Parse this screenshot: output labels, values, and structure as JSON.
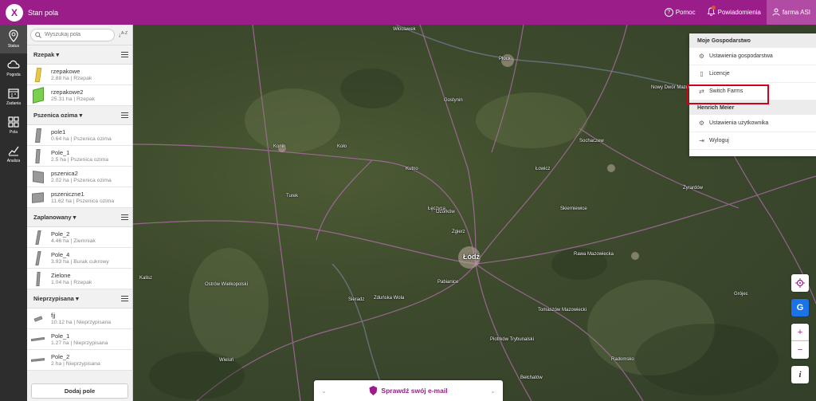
{
  "header": {
    "title": "Stan pola",
    "help": "Pomoc",
    "notifications": "Powiadomienia",
    "farm": "farma ASI"
  },
  "nav": [
    {
      "label": "Status",
      "icon": "pin-icon"
    },
    {
      "label": "Pogoda",
      "icon": "cloud-icon"
    },
    {
      "label": "Zadania",
      "icon": "calendar-icon"
    },
    {
      "label": "Pola",
      "icon": "fields-icon"
    },
    {
      "label": "Analiza",
      "icon": "chart-icon"
    }
  ],
  "search": {
    "placeholder": "Wyszukaj pola",
    "sort": "A-Z"
  },
  "groups": [
    {
      "name": "Rzepak",
      "fields": [
        {
          "name": "rzepakowe",
          "info": "2.88 ha | Rzepak"
        },
        {
          "name": "rzepakowe2",
          "info": "25.31 ha | Rzepak"
        }
      ]
    },
    {
      "name": "Pszenica ozima",
      "fields": [
        {
          "name": "pole1",
          "info": "0.64 ha | Pszenica ozima"
        },
        {
          "name": "Pole_1",
          "info": "2.5 ha | Pszenica ozima"
        },
        {
          "name": "pszenica2",
          "info": "2.02 ha | Pszenica ozima"
        },
        {
          "name": "pszeniczne1",
          "info": "11.62 ha | Pszenica ozima"
        }
      ]
    },
    {
      "name": "Zaplanowany",
      "fields": [
        {
          "name": "Pole_2",
          "info": "4.46 ha | Ziemniak"
        },
        {
          "name": "Pole_4",
          "info": "3.93 ha | Burak cukrowy"
        },
        {
          "name": "Zielone",
          "info": "1.04 ha | Rzepak"
        }
      ]
    },
    {
      "name": "Nieprzypisana",
      "fields": [
        {
          "name": "fjj",
          "info": "10.12 ha | Nieprzypisana"
        },
        {
          "name": "Pole_1",
          "info": "1.27 ha | Nieprzypisana"
        },
        {
          "name": "Pole_2",
          "info": "2 ha | Nieprzypisana"
        }
      ]
    }
  ],
  "add_field": "Dodaj pole",
  "dropdown": {
    "section1": "Moje Gospodarstwo",
    "farm_settings": "Ustawienia gospodarstwa",
    "licenses": "Licencje",
    "switch_farms": "Switch Farms",
    "section2": "Henrich Meier",
    "user_settings": "Ustawienia użytkownika",
    "logout": "Wyloguj"
  },
  "map": {
    "cities": [
      {
        "name": "Włocławek",
        "big": false
      },
      {
        "name": "Płock",
        "big": false
      },
      {
        "name": "Nowy Dwór Mazowiecki",
        "big": false
      },
      {
        "name": "Koło",
        "big": false
      },
      {
        "name": "Konin",
        "big": false
      },
      {
        "name": "Kutno",
        "big": false
      },
      {
        "name": "Łęczyca",
        "big": false
      },
      {
        "name": "Ozorków",
        "big": false
      },
      {
        "name": "Zgierz",
        "big": false
      },
      {
        "name": "Łódź",
        "big": true
      },
      {
        "name": "Łowicz",
        "big": false
      },
      {
        "name": "Skierniewice",
        "big": false
      },
      {
        "name": "Turek",
        "big": false
      },
      {
        "name": "Sieradz",
        "big": false
      },
      {
        "name": "Zduńska Wola",
        "big": false
      },
      {
        "name": "Pabianice",
        "big": false
      },
      {
        "name": "Tomaszów Mazowiecki",
        "big": false
      },
      {
        "name": "Piotrków Trybunalski",
        "big": false
      },
      {
        "name": "Rawa Mazowiecka",
        "big": false
      },
      {
        "name": "Żyrardów",
        "big": false
      },
      {
        "name": "Kalisz",
        "big": false
      },
      {
        "name": "Ostrów Wielkopolski",
        "big": false
      },
      {
        "name": "Gostynin",
        "big": false
      },
      {
        "name": "Sochaczew",
        "big": false
      },
      {
        "name": "Grójec",
        "big": false
      },
      {
        "name": "Radomsko",
        "big": false
      },
      {
        "name": "Bełchatów",
        "big": false
      },
      {
        "name": "Wieluń",
        "big": false
      }
    ]
  },
  "tools": {
    "info": "i",
    "zoom_in": "+",
    "zoom_out": "−",
    "g": "G"
  },
  "banner": "Sprawdź swój e-mail"
}
